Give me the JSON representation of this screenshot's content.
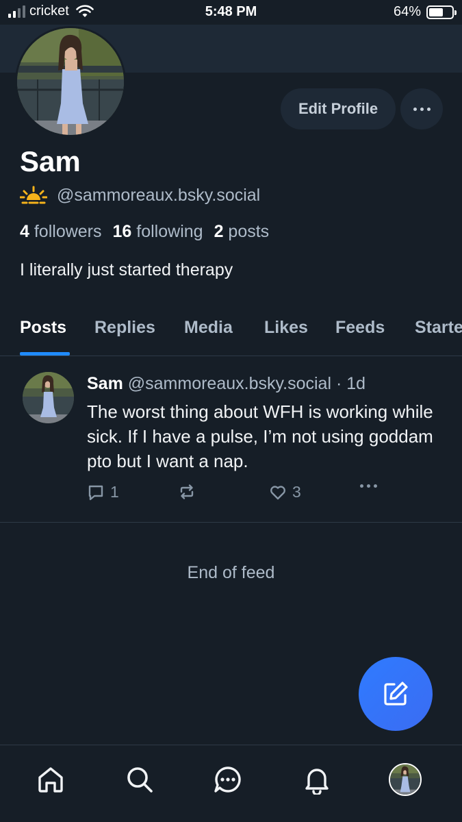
{
  "status_bar": {
    "carrier": "cricket",
    "time": "5:48 PM",
    "battery_percent": "64%",
    "battery_level": 0.64,
    "signal_bars": 2
  },
  "profile": {
    "name": "Sam",
    "handle": "@sammoreaux.bsky.social",
    "handle_icon": "sunrise-emoji-icon",
    "edit_button_label": "Edit Profile",
    "stats": {
      "followers_count": "4",
      "followers_label": "followers",
      "following_count": "16",
      "following_label": "following",
      "posts_count": "2",
      "posts_label": "posts"
    },
    "bio": "I literally just started therapy"
  },
  "tabs": [
    {
      "label": "Posts",
      "active": true
    },
    {
      "label": "Replies",
      "active": false
    },
    {
      "label": "Media",
      "active": false
    },
    {
      "label": "Likes",
      "active": false
    },
    {
      "label": "Feeds",
      "active": false
    },
    {
      "label": "Starte",
      "active": false
    }
  ],
  "post": {
    "author_name": "Sam",
    "author_handle": "@sammoreaux.bsky.social",
    "time_ago": "· 1d",
    "text": "The worst thing about WFH is working while sick. If I have a pulse, I’m not using goddam pto but I want a nap.",
    "reply_count": "1",
    "repost_count": "",
    "like_count": "3"
  },
  "feed_end_text": "End of feed",
  "colors": {
    "background": "#161e27",
    "surface": "#1e2936",
    "accent": "#208bfe",
    "muted_text": "#aebbc9"
  },
  "nav": [
    "home-icon",
    "search-icon",
    "chat-icon",
    "notifications-bell-icon",
    "profile-avatar"
  ]
}
